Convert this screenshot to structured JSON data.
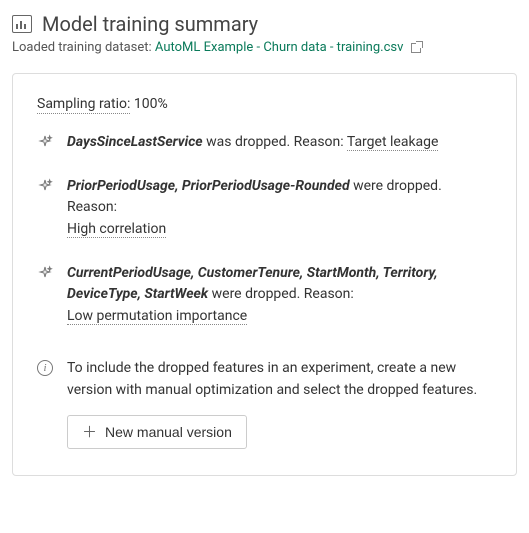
{
  "header": {
    "title": "Model training summary",
    "loaded_label": "Loaded training dataset:",
    "dataset_name": "AutoML Example - Churn data - training.csv"
  },
  "sampling": {
    "label": "Sampling ratio:",
    "value": "100%"
  },
  "drops": [
    {
      "features": "DaysSinceLastService",
      "verb": "was dropped. Reason:",
      "reason": "Target leakage",
      "reason_inline": true
    },
    {
      "features": "PriorPeriodUsage, PriorPeriodUsage-Rounded",
      "verb": "were dropped. Reason:",
      "reason": "High correlation",
      "reason_inline": false
    },
    {
      "features": "CurrentPeriodUsage, CustomerTenure, StartMonth, Territory, DeviceType, StartWeek",
      "verb": "were dropped. Reason:",
      "reason": "Low permutation importance",
      "reason_inline": false
    }
  ],
  "info": {
    "text": "To include the dropped features in an experiment, create a new version with manual optimization and select the dropped features.",
    "button": "New manual version"
  }
}
